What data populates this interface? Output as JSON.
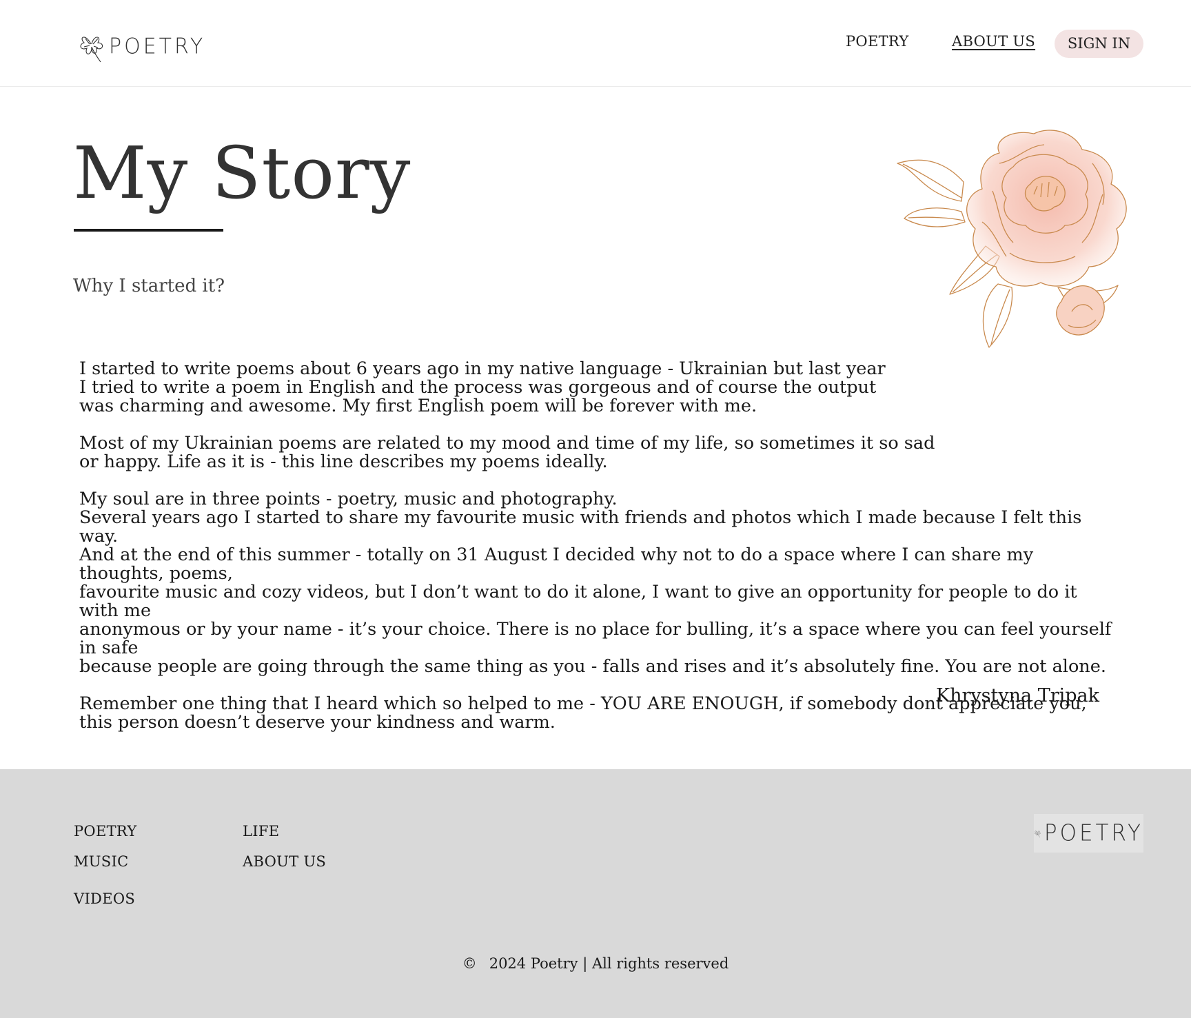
{
  "header": {
    "logo_text": "POETRY",
    "nav": {
      "poetry": "POETRY",
      "about_us": "ABOUT US",
      "sign_in": "SIGN IN"
    }
  },
  "main": {
    "title": "My Story",
    "subtitle": "Why I started it?",
    "paragraphs": [
      "I started to write poems about 6 years ago in my native language - Ukrainian but last  year\nI tried to write a poem in English and the process was gorgeous and of course the output\nwas charming and awesome. My first English poem will be forever with me.",
      "Most of my Ukrainian poems are related to my mood and time of my life, so sometimes it so sad\nor happy. Life as it is - this line describes my poems ideally.",
      "My soul are in three points - poetry, music and photography.\nSeveral years ago I started to share my favourite music with friends and photos which I made because I felt this way.\nAnd at the end of this summer - totally on 31 August I decided why not to do a space where I can share my thoughts, poems,\nfavourite music and cozy videos, but I don’t want to do it alone, I want to give an opportunity for people to do it with me\nanonymous or by your name - it’s your choice. There is no place for bulling, it’s a space where you can feel yourself in safe\nbecause people are going through the same thing as you - falls and rises and it’s absolutely fine. You are not alone.",
      "Remember one thing that I heard which so helped to me - YOU ARE ENOUGH, if somebody dont appreciate you,\nthis person doesn’t deserve your kindness and warm."
    ],
    "signature": "Khrystyna Tripak"
  },
  "footer": {
    "links": {
      "poetry": "POETRY",
      "music": "MUSIC",
      "videos": "VIDEOS",
      "life": "LIFE",
      "about_us": "ABOUT US"
    },
    "logo_text": "POETRY",
    "copyright_symbol": "©",
    "copyright_text": "2024 Poetry | All rights reserved"
  },
  "colors": {
    "signin_bg": "#f3e3e3",
    "footer_bg": "#d9d9d9",
    "flower_pink": "#f2b8a8",
    "flower_outline": "#c98a4e"
  },
  "icons": {
    "logo": "clover-flower-icon",
    "decoration": "peony-flower-illustration"
  }
}
